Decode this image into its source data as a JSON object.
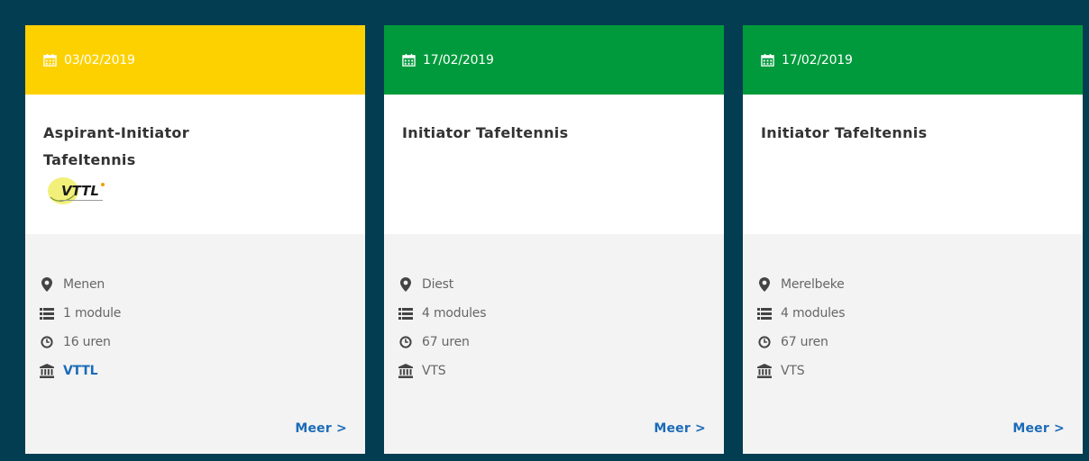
{
  "cards": [
    {
      "date": "03/02/2019",
      "header_color": "#fdd100",
      "title": "Aspirant-Initiator Tafeltennis",
      "logo_text": "VTTL",
      "location": "Menen",
      "modules": "1 module",
      "hours": "16 uren",
      "organizer": "VTTL",
      "more_label": "Meer >"
    },
    {
      "date": "17/02/2019",
      "header_color": "#009a3c",
      "title": "Initiator Tafeltennis",
      "location": "Diest",
      "modules": "4 modules",
      "hours": "67 uren",
      "organizer": "VTS",
      "more_label": "Meer >"
    },
    {
      "date": "17/02/2019",
      "header_color": "#009a3c",
      "title": "Initiator Tafeltennis",
      "location": "Merelbeke",
      "modules": "4 modules",
      "hours": "67 uren",
      "organizer": "VTS",
      "more_label": "Meer >"
    }
  ],
  "icons": {
    "date": "calendar-icon",
    "location": "map-marker-icon",
    "modules": "list-icon",
    "hours": "clock-icon",
    "organizer": "institution-icon"
  }
}
